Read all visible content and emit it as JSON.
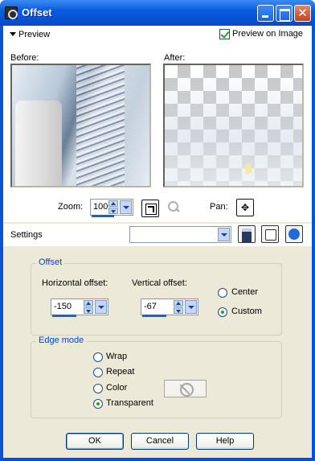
{
  "window": {
    "title": "Offset"
  },
  "preview": {
    "toggle_label": "Preview",
    "preview_on_image_label": "Preview on Image",
    "preview_on_image_checked": true,
    "before_label": "Before:",
    "after_label": "After:"
  },
  "zoom": {
    "label": "Zoom:",
    "value": "100"
  },
  "pan": {
    "label": "Pan:",
    "glyph": "✥"
  },
  "settings": {
    "label": "Settings",
    "value": ""
  },
  "offset": {
    "group_title": "Offset",
    "horizontal_label": "Horizontal offset:",
    "horizontal_value": "-150",
    "vertical_label": "Vertical offset:",
    "vertical_value": "-67",
    "center_label": "Center",
    "custom_label": "Custom",
    "selected": "Custom"
  },
  "edge_mode": {
    "group_title": "Edge mode",
    "options": [
      "Wrap",
      "Repeat",
      "Color",
      "Transparent"
    ],
    "selected": "Transparent"
  },
  "buttons": {
    "ok": "OK",
    "cancel": "Cancel",
    "help": "Help"
  },
  "icons": {
    "app": "offset-app-icon",
    "fit": "fit-to-window-icon",
    "magnifier": "magnifier-icon",
    "pan": "pan-cross-icon",
    "save": "save-preset-icon",
    "randomize": "randomize-dice-icon",
    "reset": "reset-icon",
    "color_none": "no-color-icon"
  },
  "colors": {
    "title_bar": "#0a53d6",
    "accent": "#0046d5",
    "face": "#ece9d8",
    "radio_dot": "#21a121"
  }
}
